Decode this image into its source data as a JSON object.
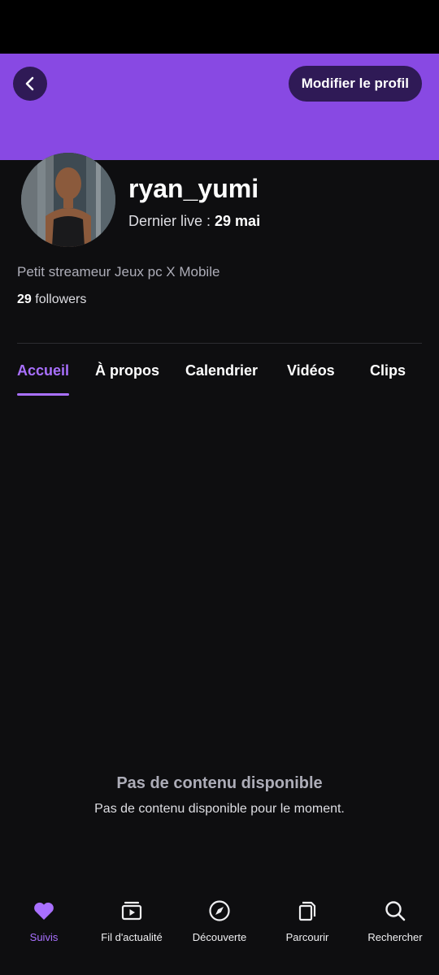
{
  "header": {
    "edit_profile_label": "Modifier le profil"
  },
  "profile": {
    "username": "ryan_yumi",
    "last_live_label": "Dernier live : ",
    "last_live_date": "29 mai",
    "bio": "Petit streameur Jeux pc X Mobile",
    "followers_count": "29",
    "followers_label": " followers"
  },
  "tabs": [
    {
      "label": "Accueil",
      "active": true
    },
    {
      "label": "À propos",
      "active": false
    },
    {
      "label": "Calendrier",
      "active": false
    },
    {
      "label": "Vidéos",
      "active": false
    },
    {
      "label": "Clips",
      "active": false
    }
  ],
  "empty_state": {
    "title": "Pas de contenu disponible",
    "subtitle": "Pas de contenu disponible pour le moment."
  },
  "bottom_nav": [
    {
      "label": "Suivis",
      "icon": "heart-icon",
      "active": true
    },
    {
      "label": "Fil d'actualité",
      "icon": "feed-play-icon",
      "active": false
    },
    {
      "label": "Découverte",
      "icon": "compass-icon",
      "active": false
    },
    {
      "label": "Parcourir",
      "icon": "copy-stack-icon",
      "active": false
    },
    {
      "label": "Rechercher",
      "icon": "search-icon",
      "active": false
    }
  ],
  "colors": {
    "accent": "#a970ff",
    "banner": "#8849e3",
    "button_dark": "#2f1a56",
    "background": "#0e0e10"
  }
}
